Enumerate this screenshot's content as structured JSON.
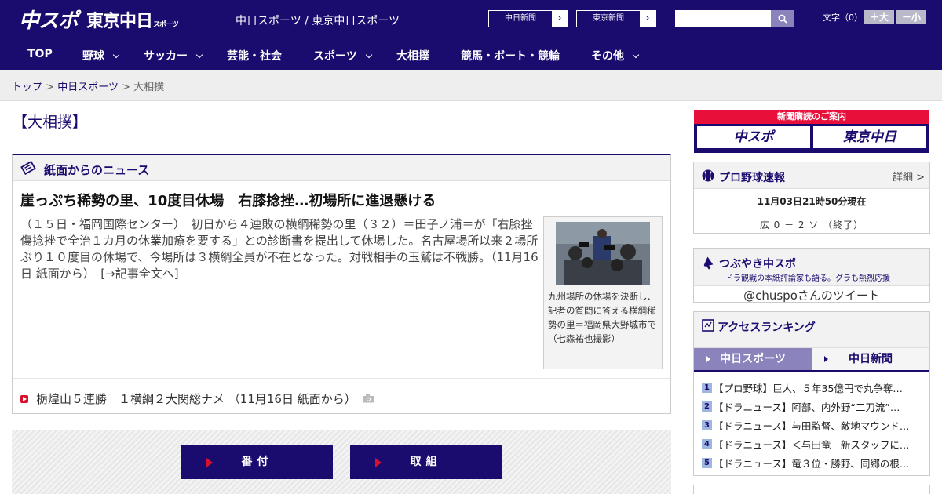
{
  "header": {
    "logo_chuspo": "中スポ",
    "logo_tokyo": "東京中日",
    "logo_tokyo_small": "スポーツ",
    "site_names": "中日スポーツ / 東京中日スポーツ",
    "chunichi_link": "中日新聞",
    "tokyo_link": "東京新聞",
    "search_value": "",
    "font_size_label": "文字（0）",
    "font_bigger": "＋大",
    "font_smaller": "－小"
  },
  "nav": {
    "items": [
      "TOP",
      "野球",
      "サッカー",
      "芸能・社会",
      "スポーツ",
      "大相撲",
      "競馬・ボート・競輪",
      "その他"
    ]
  },
  "breadcrumb": {
    "home": "トップ",
    "sep": ">",
    "section": "中日スポーツ",
    "current": "大相撲"
  },
  "main": {
    "page_title": "【大相撲】",
    "news_header": "紙面からのニュース",
    "headline": "崖っぷち稀勢の里、10度目休場　右膝捻挫…初場所に進退懸ける",
    "article": "（１５日・福岡国際センター）　初日から４連敗の横綱稀勢の里（３２）＝田子ノ浦＝が「右膝挫傷捻挫で全治１カ月の休業加療を要する」との診断書を提出して休場した。名古屋場所以来２場所ぶり１０度目の休場で、今場所は３横綱全員が不在となった。対戦相手の玉鷲は不戦勝。（11月16日 紙面から）　[→記事全文へ]",
    "photo_caption": "九州場所の休場を決断し、記者の質問に答える横綱稀勢の里＝福岡県大野城市で（七森祐也撮影）",
    "sub_news": "栃煌山５連勝　１横綱２大関総ナメ （11月16日 紙面から）",
    "btn_banzuke": "番付",
    "btn_torikumi": "取組"
  },
  "sidebar": {
    "subscribe_label": "新聞購読のご案内",
    "subscribe_logo1": "中スポ",
    "subscribe_logo2": "東京中日",
    "baseball_title": "プロ野球速報",
    "baseball_more": "詳細 >",
    "baseball_time": "11月03日21時50分現在",
    "baseball_score": "広 0 － 2 ソ （終了）",
    "tweet_title": "つぶやき中スポ",
    "tweet_sub": "ドラ観戦の本紙評論家も語る。グラも熱烈応援",
    "tweet_line": "@chuspoさんのツイート",
    "ranking_title": "アクセスランキング",
    "ranking_tab_active": "中日スポーツ",
    "ranking_tab_other": "中日新聞",
    "ranking": [
      {
        "num": "1",
        "text": "【プロ野球】巨人、５年35億円で丸争奪…"
      },
      {
        "num": "2",
        "text": "【ドラニュース】阿部、内外野“二刀流”…"
      },
      {
        "num": "3",
        "text": "【ドラニュース】与田監督、敵地マウンド…"
      },
      {
        "num": "4",
        "text": "【ドラニュース】＜与田竜　新スタッフに…"
      },
      {
        "num": "5",
        "text": "【ドラニュース】竜３位・勝野、同郷の根…"
      }
    ]
  }
}
